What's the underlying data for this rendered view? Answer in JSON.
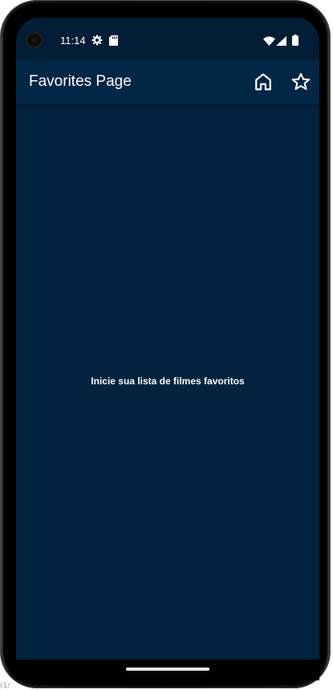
{
  "status_bar": {
    "time": "11:14",
    "icons": [
      "settings-icon",
      "sd-card-icon",
      "wifi-icon",
      "signal-icon",
      "battery-icon"
    ]
  },
  "app_bar": {
    "title": "Favorites Page",
    "actions": [
      "home-icon",
      "star-outline-icon"
    ]
  },
  "content": {
    "empty_message": "Inicie sua lista de filmes favoritos"
  },
  "colors": {
    "background": "#012340",
    "app_bar": "#012646",
    "status_bar": "#011e36",
    "text": "#ffffff"
  }
}
